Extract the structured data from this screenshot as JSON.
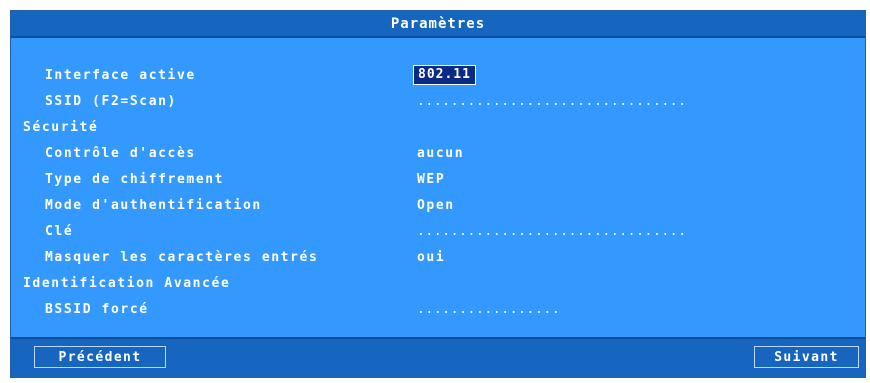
{
  "title": "Paramètres",
  "rows": [
    {
      "label": "Interface active",
      "value": "802.11"
    },
    {
      "label": "SSID (F2=Scan)",
      "value": "................................"
    },
    {
      "label": "Sécurité"
    },
    {
      "label": "Contrôle d'accès",
      "value": "aucun"
    },
    {
      "label": "Type de chiffrement",
      "value": "WEP"
    },
    {
      "label": "Mode d'authentification",
      "value": "Open"
    },
    {
      "label": "Clé",
      "value": "................................"
    },
    {
      "label": "Masquer les caractères entrés",
      "value": "oui"
    },
    {
      "label": "Identification Avancée"
    },
    {
      "label": "BSSID forcé",
      "value": "................."
    }
  ],
  "buttons": {
    "previous": "Précédent",
    "next": "Suivant"
  },
  "colors": {
    "panel": "#3399ff",
    "bar": "#1666c0",
    "selection": "#0a2a88",
    "text": "#ffffff"
  }
}
